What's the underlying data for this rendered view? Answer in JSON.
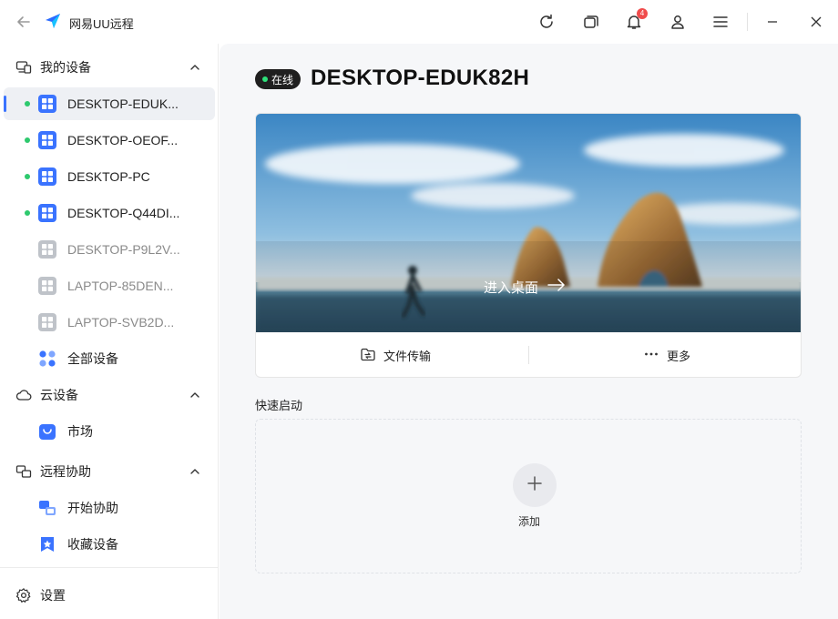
{
  "app": {
    "title": "网易UU远程",
    "notification_count": "4"
  },
  "sidebar": {
    "my_devices": {
      "label": "我的设备",
      "devices": [
        {
          "name": "DESKTOP-EDUK...",
          "online": true,
          "selected": true
        },
        {
          "name": "DESKTOP-OEOF...",
          "online": true
        },
        {
          "name": "DESKTOP-PC",
          "online": true
        },
        {
          "name": "DESKTOP-Q44DI...",
          "online": true
        },
        {
          "name": "DESKTOP-P9L2V...",
          "online": false
        },
        {
          "name": "LAPTOP-85DEN...",
          "online": false
        },
        {
          "name": "LAPTOP-SVB2D...",
          "online": false
        }
      ],
      "all_devices_label": "全部设备"
    },
    "cloud": {
      "label": "云设备",
      "market_label": "市场"
    },
    "remote_assist": {
      "label": "远程协助",
      "start_label": "开始协助",
      "favorites_label": "收藏设备"
    },
    "settings_label": "设置"
  },
  "main": {
    "status_label": "在线",
    "device_title": "DESKTOP-EDUK82H",
    "enter_desktop_label": "进入桌面",
    "file_transfer_label": "文件传输",
    "more_label": "更多",
    "quick_start_title": "快速启动",
    "add_label": "添加"
  },
  "colors": {
    "accent": "#3a73ff",
    "online": "#2ec96e",
    "badge": "#f04c4c"
  }
}
